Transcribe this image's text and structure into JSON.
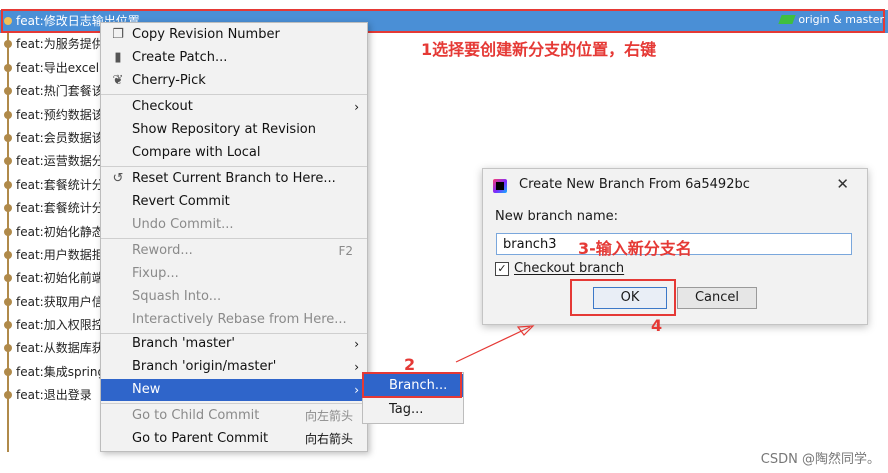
{
  "commits": [
    "feat:修改日志输出位置",
    "feat:为服务提供",
    "feat:导出excel",
    "feat:热门套餐该",
    "feat:预约数据该",
    "feat:会员数据该",
    "feat:运营数据分",
    "feat:套餐统计分",
    "feat:套餐统计分",
    "feat:初始化静态",
    "feat:用户数据拒",
    "feat:初始化前端",
    "feat:获取用户信",
    "feat:加入权限控",
    "feat:从数据库获",
    "feat:集成spring",
    "feat:退出登录"
  ],
  "selected_ref": "origin & master",
  "context_menu": {
    "copy_revision": "Copy Revision Number",
    "create_patch": "Create Patch...",
    "cherry_pick": "Cherry-Pick",
    "checkout": "Checkout",
    "show_repo": "Show Repository at Revision",
    "compare_local": "Compare with Local",
    "reset_branch": "Reset Current Branch to Here...",
    "revert_commit": "Revert Commit",
    "undo_commit": "Undo Commit...",
    "reword": "Reword...",
    "reword_shortcut": "F2",
    "fixup": "Fixup...",
    "squash": "Squash Into...",
    "interactive_rebase": "Interactively Rebase from Here...",
    "branch_master": "Branch 'master'",
    "branch_origin_master": "Branch 'origin/master'",
    "new": "New",
    "go_child": "Go to Child Commit",
    "go_child_shortcut": "向左箭头",
    "go_parent": "Go to Parent Commit",
    "go_parent_shortcut": "向右箭头"
  },
  "submenu": {
    "branch": "Branch...",
    "tag": "Tag..."
  },
  "dialog": {
    "title": "Create New Branch From 6a5492bc",
    "label": "New branch name:",
    "value": "branch3",
    "checkout_label": "Checkout branch",
    "checkout_checked": true,
    "ok": "OK",
    "cancel": "Cancel"
  },
  "annotations": {
    "step1": "1选择要创建新分支的位置，右键",
    "step2": "2",
    "step3": "3-输入新分支名",
    "step4": "4"
  },
  "watermark": "CSDN @陶然同学。",
  "colors": {
    "selection": "#4a8fd6",
    "menu_highlight": "#2f65ca",
    "annotation_red": "#e53935",
    "graph": "#b08a4a"
  }
}
